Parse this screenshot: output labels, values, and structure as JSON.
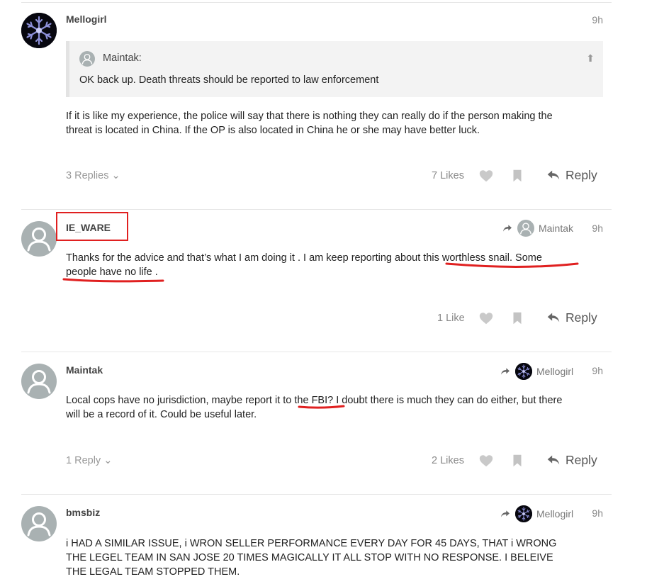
{
  "accent_red": "#e02020",
  "posts": [
    {
      "username": "Mellogirl",
      "time": "9h",
      "avatar_icon": "snowflake-icon",
      "quote": {
        "author": "Maintak:",
        "text": "OK back up. Death threats should be reported to law enforcement"
      },
      "body_lines": [
        "If it is like my experience, the police will say that there is nothing they can really do if the person making the",
        "threat is located in China. If the OP is also located in China he or she may have better luck."
      ],
      "replies_label": "3 Replies",
      "likes_label": "7 Likes",
      "reply_label": "Reply"
    },
    {
      "username": "IE_WARE",
      "time": "9h",
      "reply_to": "Maintak",
      "body_lines": [
        "Thanks for the advice and that’s what I am doing it . I am keep reporting about this worthless snail. Some",
        "people have no life ."
      ],
      "likes_label": "1 Like",
      "reply_label": "Reply"
    },
    {
      "username": "Maintak",
      "time": "9h",
      "reply_to": "Mellogirl",
      "body_lines": [
        "Local cops have no jurisdiction, maybe report it to the FBI? I doubt there is much they can do either, but there",
        "will be a record of it. Could be useful later."
      ],
      "replies_label": "1 Reply",
      "likes_label": "2 Likes",
      "reply_label": "Reply"
    },
    {
      "username": "bmsbiz",
      "time": "9h",
      "reply_to": "Mellogirl",
      "body_lines": [
        "i HAD A SIMILAR ISSUE, i WRON SELLER PERFORMANCE EVERY DAY FOR 45 DAYS, THAT i WRONG",
        "THE LEGEL TEAM IN SAN JOSE 20 TIMES MAGICALLY IT ALL STOP WITH NO RESPONSE. I BELEIVE",
        "THE LEGAL TEAM STOPPED THEM."
      ]
    }
  ]
}
